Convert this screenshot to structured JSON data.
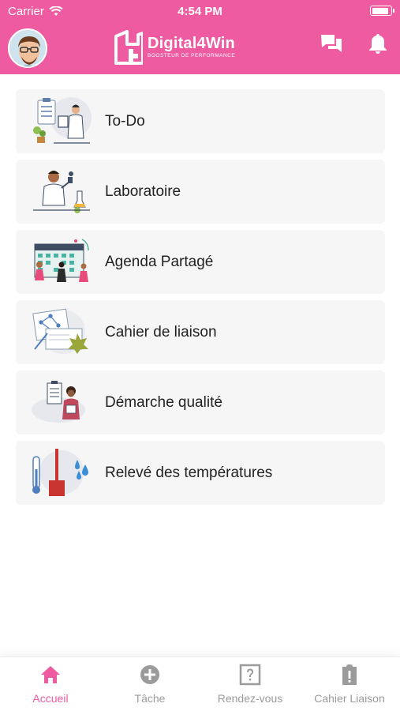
{
  "status_bar": {
    "carrier": "Carrier",
    "time": "4:54 PM"
  },
  "header": {
    "logo_title": "Digital4Win",
    "logo_subtitle": "BOOSTEUR DE PERFORMANCE",
    "brand_color": "#ef5ba1",
    "icons": [
      "avatar",
      "chat-icon",
      "bell-icon"
    ]
  },
  "menu": {
    "items": [
      {
        "label": "To-Do",
        "icon": "todo-illustration"
      },
      {
        "label": "Laboratoire",
        "icon": "laboratory-illustration"
      },
      {
        "label": "Agenda Partagé",
        "icon": "calendar-illustration"
      },
      {
        "label": "Cahier de liaison",
        "icon": "notebook-illustration"
      },
      {
        "label": "Démarche qualité",
        "icon": "quality-illustration"
      },
      {
        "label": "Relevé des températures",
        "icon": "thermometer-illustration"
      }
    ]
  },
  "tab_bar": {
    "active_color": "#ef5ba1",
    "inactive_color": "#9b9b9b",
    "tabs": [
      {
        "label": "Accueil",
        "icon": "home-icon",
        "active": true
      },
      {
        "label": "Tâche",
        "icon": "plus-circle-icon",
        "active": false
      },
      {
        "label": "Rendez-vous",
        "icon": "question-box-icon",
        "active": false
      },
      {
        "label": "Cahier Liaison",
        "icon": "clipboard-alert-icon",
        "active": false
      }
    ]
  }
}
